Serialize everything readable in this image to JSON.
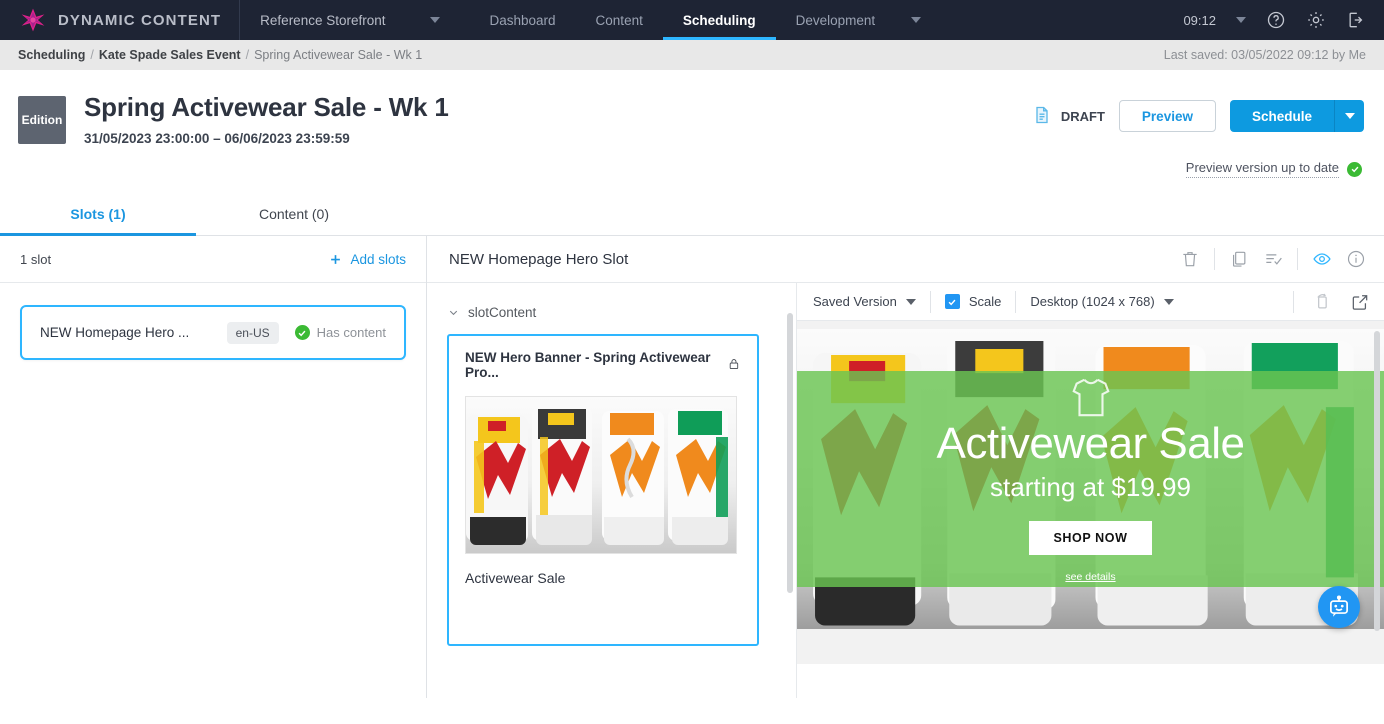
{
  "topnav": {
    "brand": "DYNAMIC CONTENT",
    "logo_icon": "amplience-star-icon",
    "realm": "Reference Storefront",
    "realm_caret_icon": "chevron-down-icon",
    "tabs": [
      {
        "label": "Dashboard",
        "active": false
      },
      {
        "label": "Content",
        "active": false
      },
      {
        "label": "Scheduling",
        "active": true
      },
      {
        "label": "Development",
        "active": false
      }
    ],
    "more_icon": "chevron-down-icon",
    "clock": "09:12",
    "clock_caret_icon": "chevron-down-icon",
    "help_icon": "help-circle-icon",
    "settings_icon": "gear-icon",
    "logout_icon": "logout-icon"
  },
  "breadcrumb": {
    "items": [
      "Scheduling",
      "Kate Spade Sales Event",
      "Spring Activewear Sale - Wk 1"
    ],
    "separator": "/",
    "last_saved": "Last saved: 03/05/2022 09:12 by Me"
  },
  "header": {
    "badge": "Edition",
    "title": "Spring Activewear Sale - Wk 1",
    "date_range": "31/05/2023 23:00:00  –  06/06/2023 23:59:59",
    "status_icon": "document-icon",
    "status": "DRAFT",
    "preview_button": "Preview",
    "schedule_button": "Schedule",
    "schedule_caret_icon": "chevron-down-icon",
    "preview_status": "Preview version up to date",
    "preview_status_icon": "check-circle-icon"
  },
  "tabs": [
    {
      "label": "Slots (1)",
      "active": true
    },
    {
      "label": "Content (0)",
      "active": false
    }
  ],
  "left_panel": {
    "count_label": "1 slot",
    "add_slots_label": "Add slots",
    "add_icon": "plus-icon",
    "slot": {
      "name": "NEW Homepage Hero ...",
      "locale": "en-US",
      "status": "Has content",
      "status_icon": "check-circle-icon"
    }
  },
  "right_panel": {
    "title": "NEW Homepage Hero Slot",
    "icons": [
      {
        "name": "delete-icon"
      },
      {
        "name": "copy-icon"
      },
      {
        "name": "list-check-icon"
      },
      {
        "name": "visibility-icon"
      },
      {
        "name": "info-icon"
      }
    ],
    "tree": {
      "root_label": "slotContent",
      "expand_icon": "chevron-down-icon",
      "card": {
        "title": "NEW Hero Banner - Spring Activewear Pro...",
        "lock_icon": "lock-icon",
        "caption": "Activewear Sale",
        "image_alt": "sneakers-photo"
      }
    },
    "preview_toolbar": {
      "version_label": "Saved Version",
      "version_caret_icon": "chevron-down-icon",
      "scale_label": "Scale",
      "scale_checked": true,
      "device_label": "Desktop (1024 x 768)",
      "device_caret_icon": "chevron-down-icon",
      "refresh_icon": "rotate-icon",
      "open_external_icon": "external-link-icon"
    },
    "preview": {
      "headline": "Activewear Sale",
      "subhead": "starting at $19.99",
      "cta": "SHOP NOW",
      "details_link": "see details",
      "hero_icon": "tshirt-icon",
      "overlay_color": "#6ac452"
    },
    "bot_icon": "chatbot-icon"
  },
  "colors": {
    "nav_bg": "#1e2434",
    "accent": "#1b96e0",
    "primary": "#0d9ae0",
    "highlight": "#2eb6ff",
    "green": "#3bba34"
  }
}
